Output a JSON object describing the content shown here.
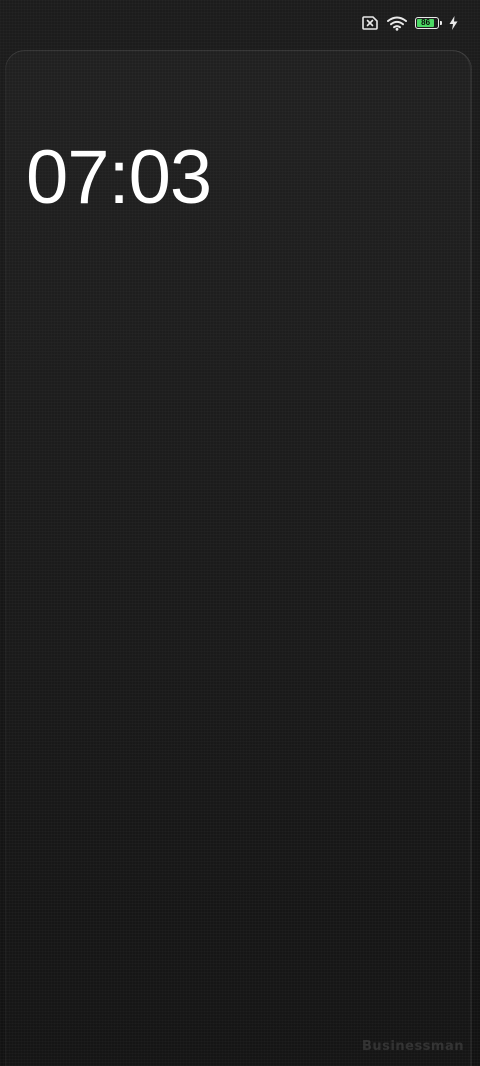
{
  "status_bar": {
    "sim_icon": "sim-none-icon",
    "wifi_icon": "wifi-icon",
    "battery_level": "86",
    "battery_color": "#4cd964",
    "charging_icon": "lightning-bolt-icon"
  },
  "lockscreen": {
    "time": "07:03",
    "watermark": "Businessman"
  }
}
